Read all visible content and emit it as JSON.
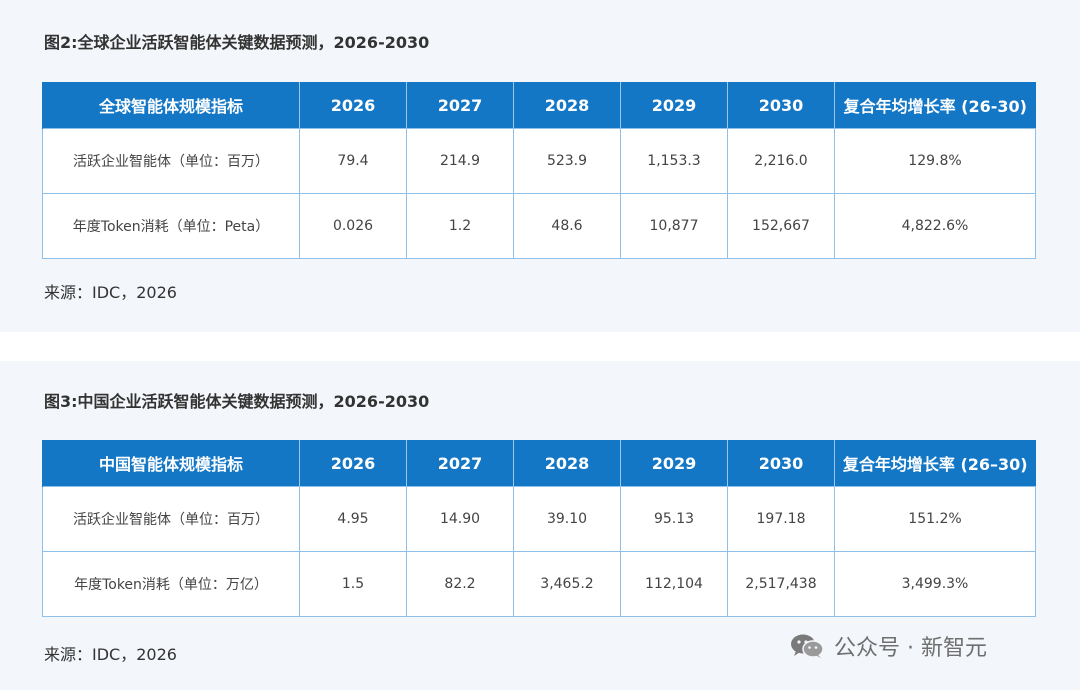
{
  "figures": [
    {
      "title": "图2:全球企业活跃智能体关键数据预测，2026-2030",
      "header": [
        "全球智能体规模指标",
        "2026",
        "2027",
        "2028",
        "2029",
        "2030",
        "复合年均增长率 (26-30)"
      ],
      "rows": [
        [
          "活跃企业智能体（单位：百万）",
          "79.4",
          "214.9",
          "523.9",
          "1,153.3",
          "2,216.0",
          "129.8%"
        ],
        [
          "年度Token消耗（单位：Peta）",
          "0.026",
          "1.2",
          "48.6",
          "10,877",
          "152,667",
          "4,822.6%"
        ]
      ],
      "source": "来源：IDC，2026"
    },
    {
      "title": "图3:中国企业活跃智能体关键数据预测，2026-2030",
      "header": [
        "中国智能体规模指标",
        "2026",
        "2027",
        "2028",
        "2029",
        "2030",
        "复合年均增长率 (26–30)"
      ],
      "rows": [
        [
          "活跃企业智能体（单位：百万）",
          "4.95",
          "14.90",
          "39.10",
          "95.13",
          "197.18",
          "151.2%"
        ],
        [
          "年度Token消耗（单位：万亿）",
          "1.5",
          "82.2",
          "3,465.2",
          "112,104",
          "2,517,438",
          "3,499.3%"
        ]
      ],
      "source": "来源：IDC，2026"
    }
  ],
  "watermark": {
    "text": "公众号 · 新智元",
    "icon": "wechat-icon"
  }
}
